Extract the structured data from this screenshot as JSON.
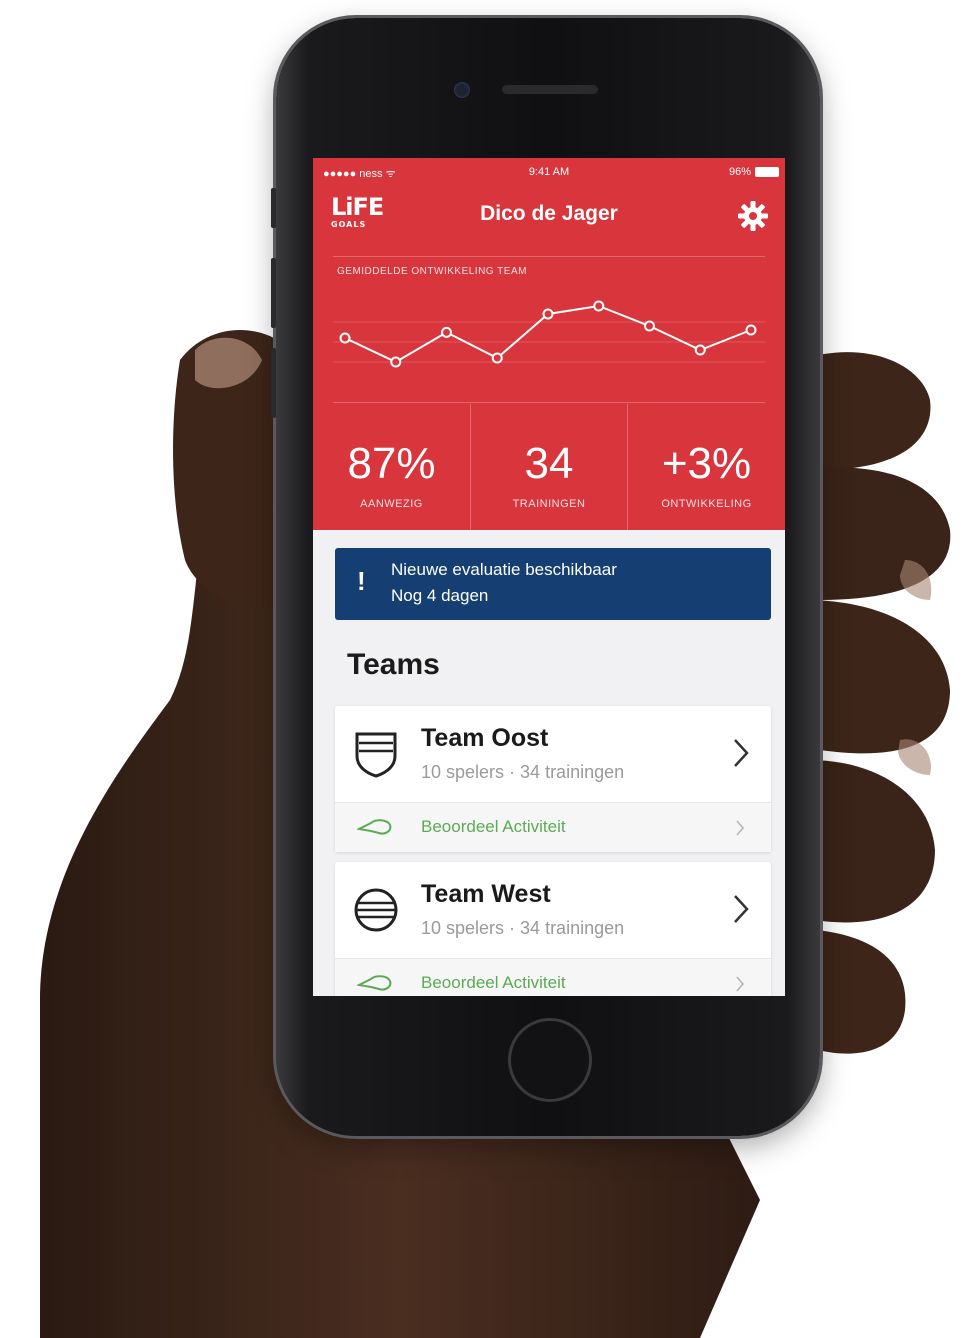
{
  "status_bar": {
    "carrier": "●●●●● ness ᯤ",
    "time": "9:41 AM",
    "battery": "96%"
  },
  "header": {
    "logo_main": "LiFE",
    "logo_sub": "GOALS",
    "title": "Dico de Jager",
    "settings_icon": "gear-icon"
  },
  "chart": {
    "title": "GEMIDDELDE ONTWIKKELING TEAM"
  },
  "chart_data": {
    "type": "line",
    "title": "GEMIDDELDE ONTWIKKELING TEAM",
    "series": [
      {
        "values": [
          0.55,
          0.25,
          0.62,
          0.3,
          0.85,
          0.95,
          0.7,
          0.4,
          0.65
        ]
      }
    ],
    "ylim": [
      0,
      1
    ],
    "grid": true,
    "legend": "none",
    "colors": {
      "line": "#ffffff"
    }
  },
  "stats": [
    {
      "value": "87%",
      "label": "AANWEZIG"
    },
    {
      "value": "34",
      "label": "TRAININGEN"
    },
    {
      "value": "+3%",
      "label": "ONTWIKKELING"
    }
  ],
  "banner": {
    "icon": "!",
    "line1": "Nieuwe evaluatie beschikbaar",
    "line2": "Nog 4 dagen"
  },
  "teams_heading": "Teams",
  "teams": [
    {
      "name": "Team Oost",
      "meta": "10 spelers · 34 trainingen",
      "icon": "shield-icon",
      "action": "Beoordeel Activiteit"
    },
    {
      "name": "Team West",
      "meta": "10 spelers · 34 trainingen",
      "icon": "ball-icon",
      "action": "Beoordeel Activiteit"
    }
  ],
  "colors": {
    "brand_red": "#d8353c",
    "banner_blue": "#153f73",
    "action_green": "#5daa55"
  }
}
